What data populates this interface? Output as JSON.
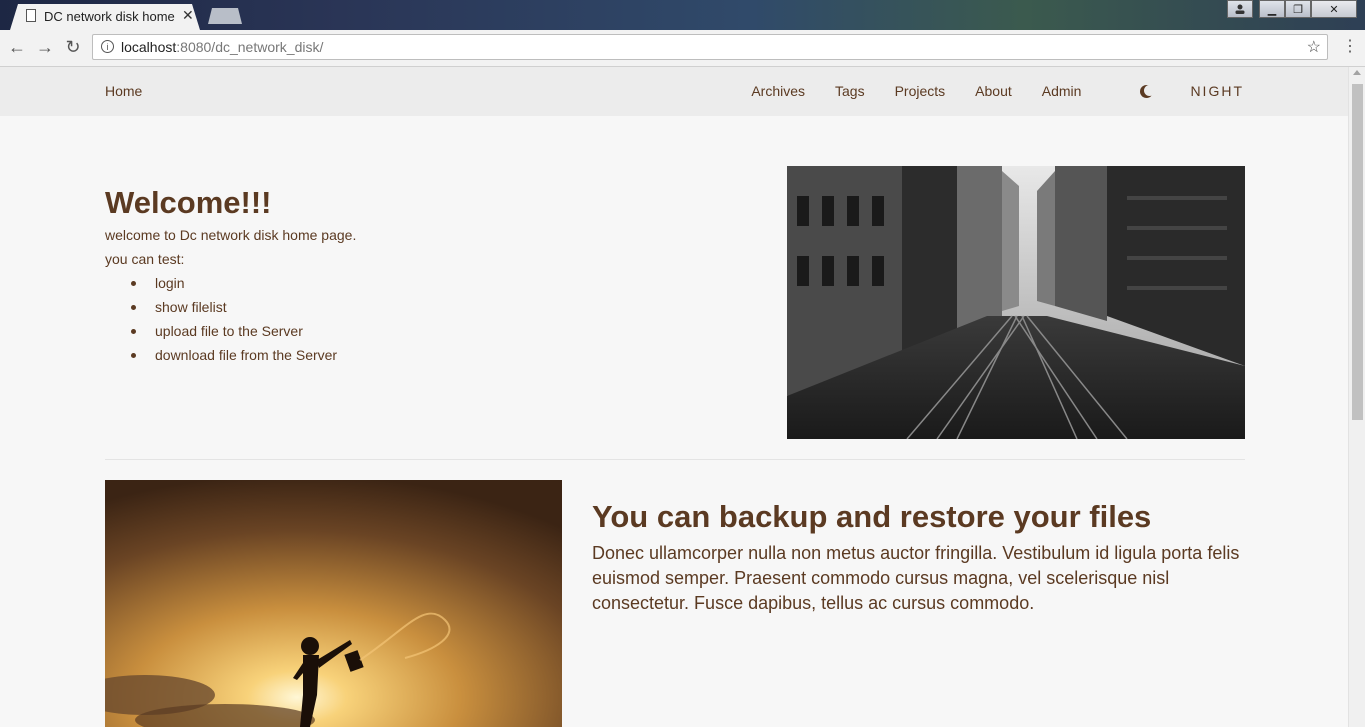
{
  "browser": {
    "tab_title": "DC network disk home",
    "url_host": "localhost",
    "url_rest": ":8080/dc_network_disk/"
  },
  "nav": {
    "home": "Home",
    "links": [
      "Archives",
      "Tags",
      "Projects",
      "About",
      "Admin"
    ],
    "night": "NIGHT"
  },
  "welcome": {
    "title": "Welcome!!!",
    "line1": "welcome to Dc network disk home page.",
    "line2": "you can test:",
    "items": [
      "login",
      "show filelist",
      "upload file to the Server",
      "download file from the Server"
    ]
  },
  "feature": {
    "title": "You can backup and restore your files",
    "text": "Donec ullamcorper nulla non metus auctor fringilla. Vestibulum id ligula porta felis euismod semper. Praesent commodo cursus magna, vel scelerisque nisl consectetur. Fusce dapibus, tellus ac cursus commodo."
  },
  "colors": {
    "text": "#5b3a22",
    "nav_bg": "#ececec",
    "page_bg": "#f7f7f7"
  },
  "icons": [
    "page-icon",
    "close-icon",
    "back-icon",
    "forward-icon",
    "reload-icon",
    "info-icon",
    "star-icon",
    "menu-icon",
    "moon-icon"
  ]
}
